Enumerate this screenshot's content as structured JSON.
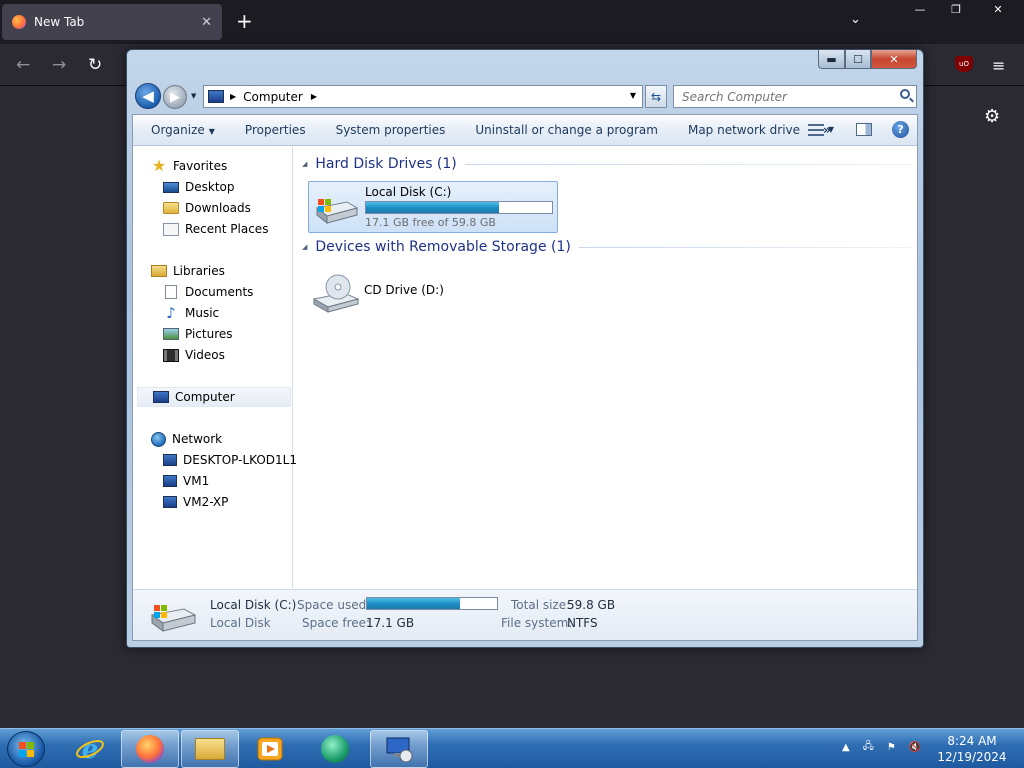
{
  "firefox": {
    "tab_title": "New Tab",
    "tab_close_glyph": "✕",
    "new_tab_glyph": "+",
    "list_tabs_glyph": "⌄",
    "window_minimize": "—",
    "window_restore": "❐",
    "window_close": "✕",
    "back_glyph": "←",
    "forward_glyph": "→",
    "reload_glyph": "↻",
    "menu_glyph": "≡",
    "extension_label": "uO",
    "settings_glyph": "⚙",
    "icons": [
      "firefox-icon",
      "ublock-icon",
      "gear-icon"
    ]
  },
  "explorer": {
    "window_controls": {
      "minimize": "▬",
      "maximize": "☐",
      "close": "✕"
    },
    "nav": {
      "back_glyph": "◀",
      "forward_glyph": "▶",
      "history_glyph": "▼"
    },
    "address": {
      "separator": "▶",
      "crumb": "Computer",
      "crumb_sep": "▶",
      "dropdown": "▼",
      "refresh_glyph": "⇆"
    },
    "search": {
      "placeholder": "Search Computer"
    },
    "commands": {
      "organize": "Organize",
      "organize_arrow": "▼",
      "properties": "Properties",
      "system_properties": "System properties",
      "uninstall": "Uninstall or change a program",
      "map_network_drive": "Map network drive",
      "more": "»",
      "views_arrow": "▼",
      "help": "?"
    },
    "sidebar": {
      "favorites": "Favorites",
      "favorites_items": [
        "Desktop",
        "Downloads",
        "Recent Places"
      ],
      "libraries": "Libraries",
      "libraries_items": [
        "Documents",
        "Music",
        "Pictures",
        "Videos"
      ],
      "computer": "Computer",
      "network": "Network",
      "network_items": [
        "DESKTOP-LKOD1L1",
        "VM1",
        "VM2-XP"
      ],
      "star_glyph": "★",
      "music_glyph": "♪"
    },
    "groups": {
      "hard_disk": {
        "title": "Hard Disk Drives (1)",
        "toggle": "◢"
      },
      "removable": {
        "title": "Devices with Removable Storage (1)",
        "toggle": "◢"
      }
    },
    "drive_c": {
      "name": "Local Disk (C:)",
      "free_text": "17.1 GB free of 59.8 GB",
      "used_fraction": 0.714
    },
    "drive_d": {
      "name": "CD Drive (D:)"
    },
    "details": {
      "name": "Local Disk (C:)",
      "type": "Local Disk",
      "space_used_label": "Space used:",
      "space_free_label": "Space free:",
      "space_free_value": "17.1 GB",
      "total_size_label": "Total size:",
      "total_size_value": "59.8 GB",
      "file_system_label": "File system:",
      "file_system_value": "NTFS",
      "used_fraction": 0.714
    }
  },
  "taskbar": {
    "pinned": [
      "windows-start-icon",
      "internet-explorer-icon",
      "firefox-icon",
      "file-explorer-icon",
      "media-player-icon",
      "app-icon",
      "remote-desktop-icon"
    ],
    "tray": {
      "show_hidden": "▲",
      "network": "🖧",
      "flag": "⚑",
      "volume": "🔇"
    },
    "time": "8:24 AM",
    "date": "12/19/2024"
  }
}
